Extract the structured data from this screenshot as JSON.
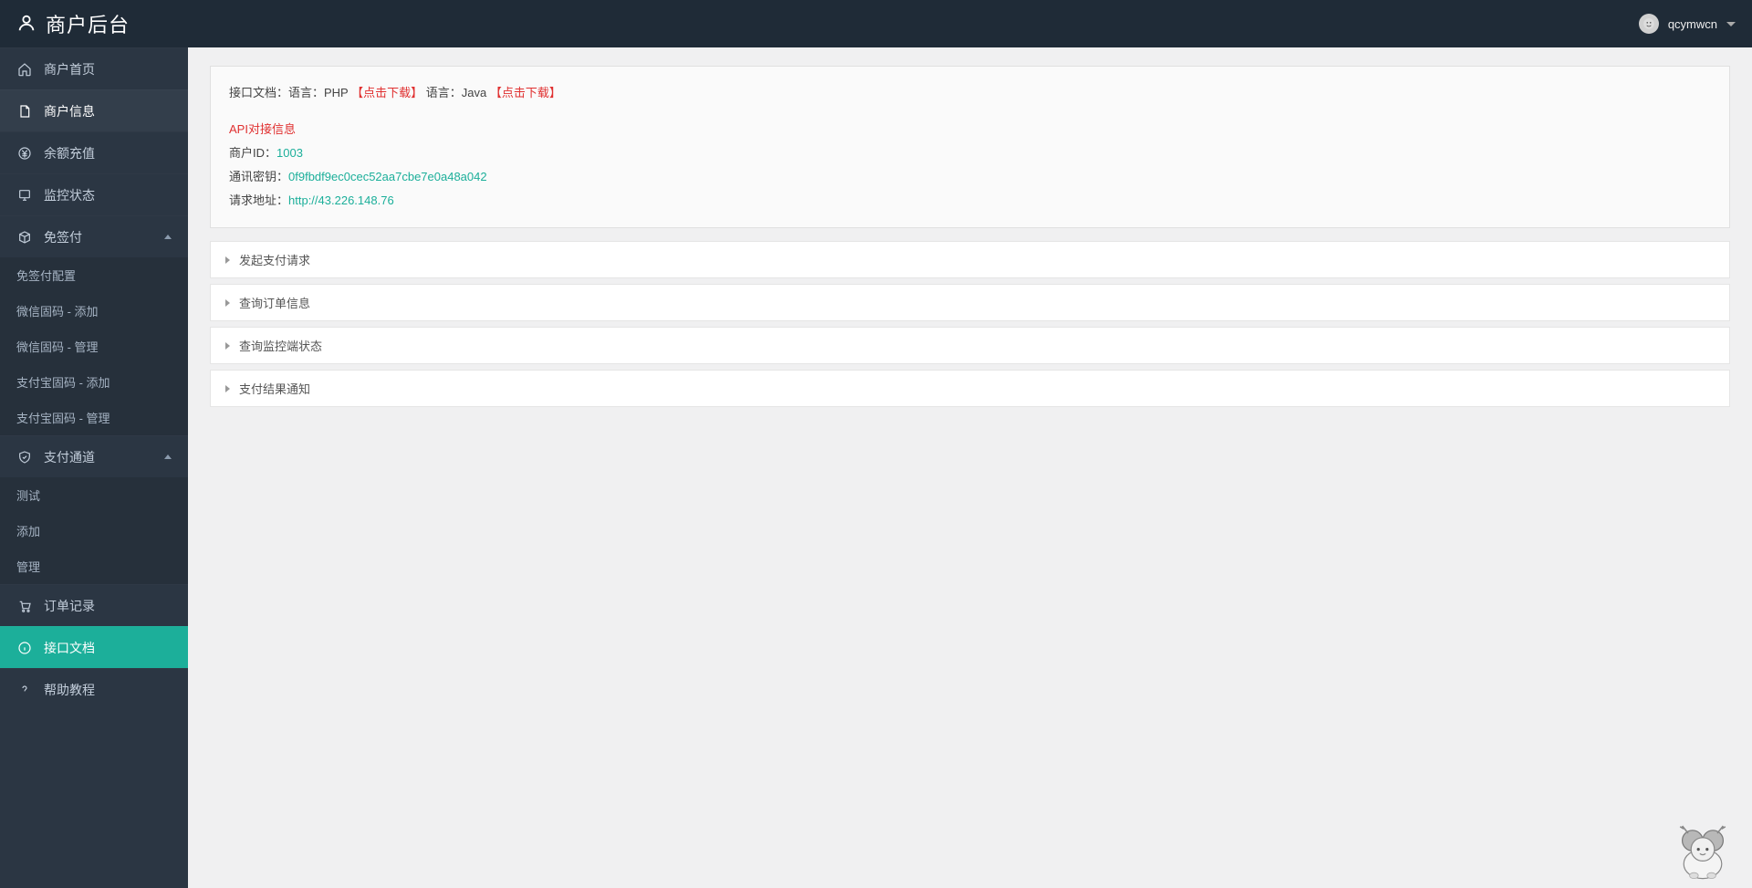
{
  "header": {
    "brand": "商户后台",
    "username": "qcymwcn"
  },
  "sidebar": {
    "home": "商户首页",
    "merchant_info": "商户信息",
    "recharge": "余额充值",
    "monitor": "监控状态",
    "exempt": "免签付",
    "exempt_sub": {
      "config": "免签付配置",
      "wx_add": "微信固码 - 添加",
      "wx_manage": "微信固码 - 管理",
      "ali_add": "支付宝固码 - 添加",
      "ali_manage": "支付宝固码 - 管理"
    },
    "channel": "支付通道",
    "channel_sub": {
      "test": "测试",
      "add": "添加",
      "manage": "管理"
    },
    "orders": "订单记录",
    "api_docs": "接口文档",
    "help": "帮助教程"
  },
  "panel": {
    "docline_prefix": "接口文档：语言：PHP",
    "download1": "【点击下载】",
    "docline_mid": "语言：Java",
    "download2": "【点击下载】",
    "api_info_title": "API对接信息",
    "merchant_id_label": "商户ID：",
    "merchant_id_value": "1003",
    "key_label": "通讯密钥：",
    "key_value": "0f9fbdf9ec0cec52aa7cbe7e0a48a042",
    "addr_label": "请求地址：",
    "addr_value": "http://43.226.148.76"
  },
  "accordion": {
    "a1": "发起支付请求",
    "a2": "查询订单信息",
    "a3": "查询监控端状态",
    "a4": "支付结果通知"
  }
}
